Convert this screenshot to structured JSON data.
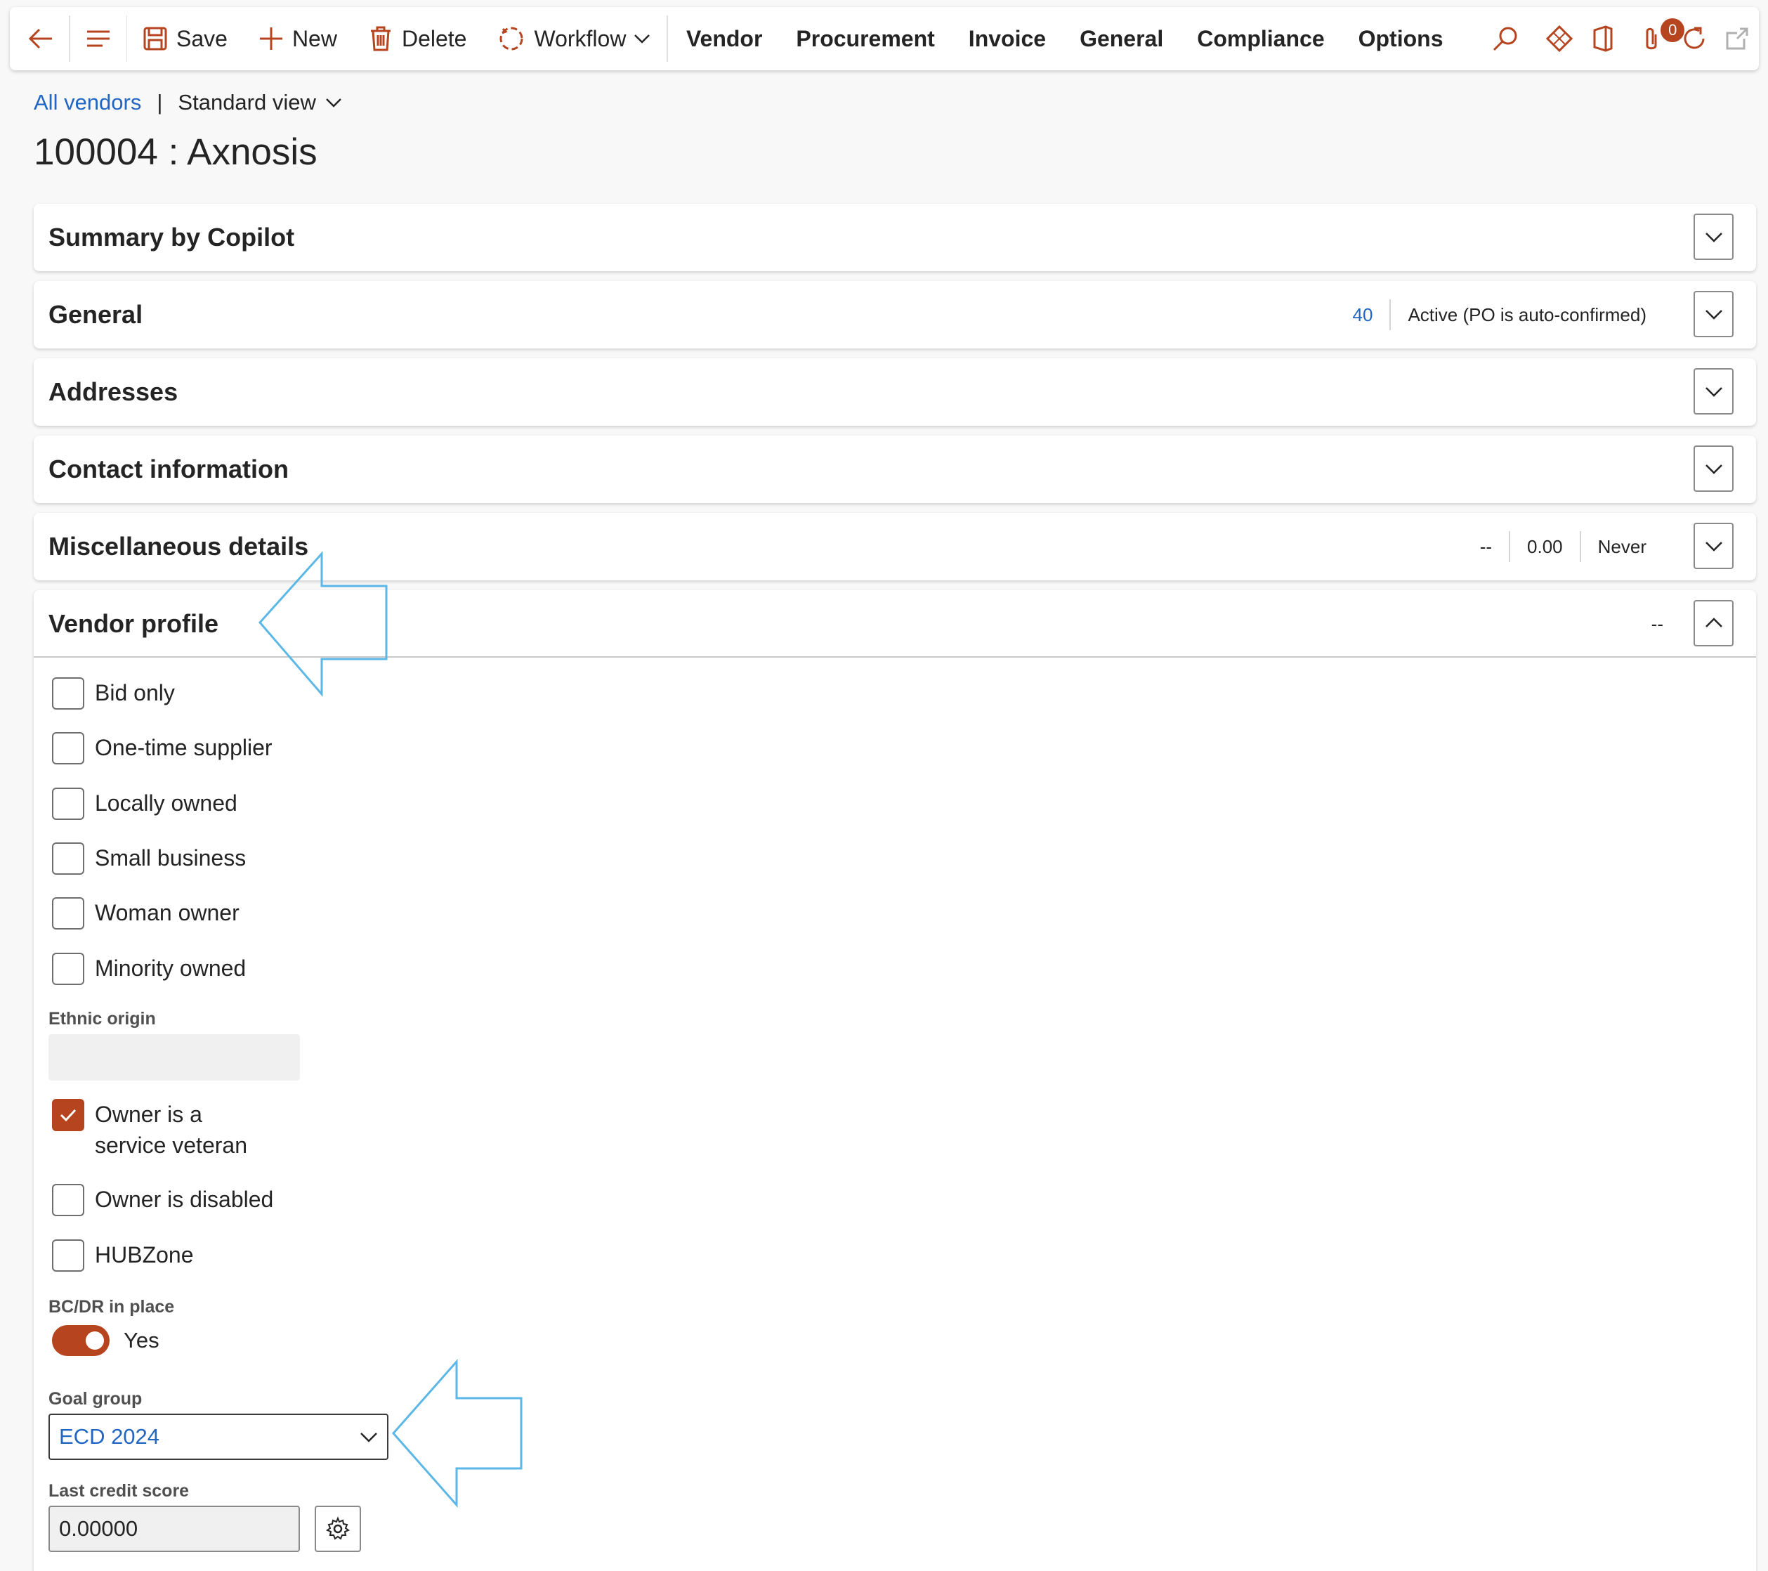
{
  "toolbar": {
    "save_label": "Save",
    "new_label": "New",
    "delete_label": "Delete",
    "workflow_label": "Workflow",
    "menus": [
      "Vendor",
      "Procurement",
      "Invoice",
      "General",
      "Compliance",
      "Options"
    ],
    "attachments_badge": "0"
  },
  "header": {
    "breadcrumb_link": "All vendors",
    "breadcrumb_separator": "|",
    "view_name": "Standard view",
    "page_title": "100004 : Axnosis"
  },
  "sections": {
    "copilot": {
      "title": "Summary by Copilot"
    },
    "general": {
      "title": "General",
      "summary_value": "40",
      "summary_status": "Active (PO is auto-confirmed)"
    },
    "addresses": {
      "title": "Addresses"
    },
    "contact": {
      "title": "Contact information"
    },
    "misc": {
      "title": "Miscellaneous details",
      "summary": [
        "--",
        "0.00",
        "Never"
      ]
    },
    "vendor_profile": {
      "title": "Vendor profile",
      "summary": "--"
    }
  },
  "vendor_profile": {
    "checkboxes": [
      {
        "label": "Bid only",
        "checked": false
      },
      {
        "label": "One-time supplier",
        "checked": false
      },
      {
        "label": "Locally owned",
        "checked": false
      },
      {
        "label": "Small business",
        "checked": false
      },
      {
        "label": "Woman owner",
        "checked": false
      },
      {
        "label": "Minority owned",
        "checked": false
      }
    ],
    "ethnic_origin": {
      "label": "Ethnic origin",
      "value": ""
    },
    "service_veteran": {
      "label": "Owner is a service veteran",
      "checked": true
    },
    "owner_disabled": {
      "label": "Owner is disabled",
      "checked": false
    },
    "hubzone": {
      "label": "HUBZone",
      "checked": false
    },
    "bcdr": {
      "label": "BC/DR in place",
      "value": "Yes",
      "on": true
    },
    "goal_group": {
      "label": "Goal group",
      "value": "ECD 2024"
    },
    "last_credit_score": {
      "label": "Last credit score",
      "value": "0.00000"
    }
  },
  "colors": {
    "accent": "#b5441f",
    "link": "#2266c4",
    "annotation_arrow": "#5bb8e6"
  }
}
